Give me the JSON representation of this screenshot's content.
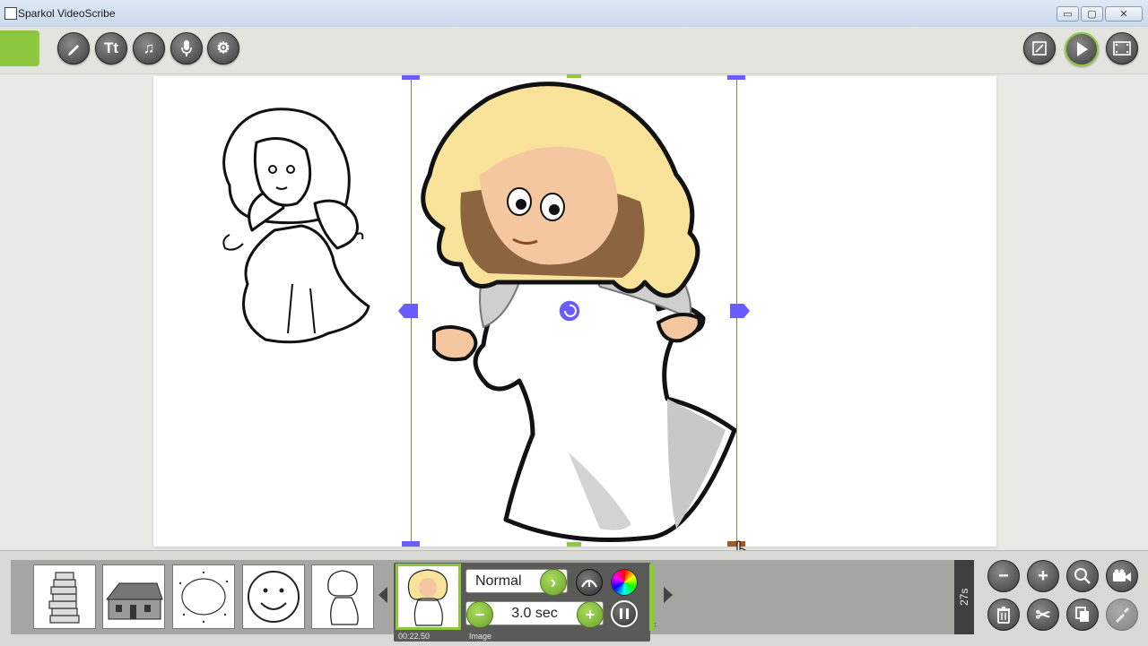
{
  "window": {
    "title": "Sparkol VideoScribe",
    "minimize": "▭",
    "maximize": "▢",
    "close": "✕"
  },
  "toolbar": {
    "left_icons": [
      "pencil-icon",
      "text-icon",
      "music-icon",
      "microphone-icon",
      "gear-icon"
    ],
    "text_label": "Tt",
    "right_icons": [
      "camera-position-icon",
      "play-icon",
      "render-video-icon"
    ]
  },
  "timeline": {
    "thumbnails": [
      "stack-of-books",
      "cottage",
      "dotted-circle",
      "smiley-face",
      "angel-sketch"
    ],
    "selected": {
      "transition": "Normal",
      "duration": "3.0 sec",
      "time": "00:22.50",
      "type": "Image",
      "close": "×"
    },
    "total_duration": "27s"
  },
  "bottom_tools": {
    "row1": [
      "zoom-out-icon",
      "zoom-in-icon",
      "zoom-fit-icon",
      "set-camera-icon"
    ],
    "row2": [
      "delete-icon",
      "cut-icon",
      "copy-icon",
      "paste-icon"
    ]
  },
  "colors": {
    "accent": "#8dc63f",
    "handle": "#6a5cff"
  }
}
